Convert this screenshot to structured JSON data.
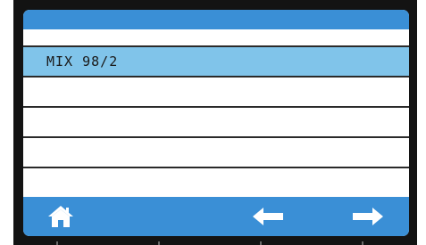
{
  "list": {
    "items": [
      {
        "label": "",
        "selected": false
      },
      {
        "label": "MIX 98/2",
        "selected": true
      },
      {
        "label": "",
        "selected": false
      },
      {
        "label": "",
        "selected": false
      },
      {
        "label": "",
        "selected": false
      },
      {
        "label": "",
        "selected": false
      }
    ]
  },
  "footer": {
    "buttons": [
      {
        "name": "home-button",
        "icon": "home-icon"
      },
      {
        "name": "back-button",
        "icon": "arrow-left-icon"
      },
      {
        "name": "forward-button",
        "icon": "arrow-right-icon"
      }
    ]
  },
  "colors": {
    "accent": "#3a8fd6",
    "selected_row": "#80c4ea",
    "bezel": "#131313",
    "icon": "#ffffff"
  }
}
